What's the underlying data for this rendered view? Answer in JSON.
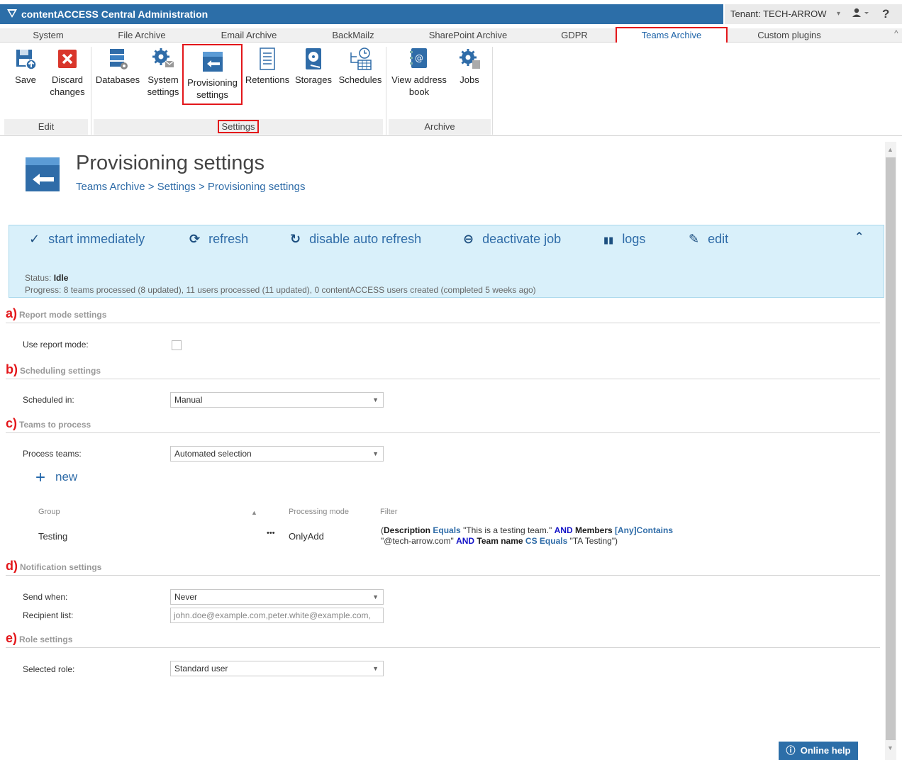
{
  "app": {
    "title": "contentACCESS Central Administration"
  },
  "tenant": {
    "label": "Tenant: TECH-ARROW",
    "help_glyph": "?"
  },
  "menu_tabs": [
    "System",
    "File Archive",
    "Email Archive",
    "BackMailz",
    "SharePoint Archive",
    "GDPR",
    "Teams Archive",
    "Custom plugins"
  ],
  "active_tab": "Teams Archive",
  "ribbon": {
    "save": "Save",
    "discard_1": "Discard",
    "discard_2": "changes",
    "databases": "Databases",
    "system_1": "System",
    "system_2": "settings",
    "prov_1": "Provisioning",
    "prov_2": "settings",
    "retentions": "Retentions",
    "storages": "Storages",
    "schedules": "Schedules",
    "address_1": "View address",
    "address_2": "book",
    "jobs": "Jobs",
    "groups": {
      "edit": "Edit",
      "settings": "Settings",
      "archive": "Archive"
    }
  },
  "page": {
    "title": "Provisioning settings",
    "breadcrumb": "Teams Archive > Settings > Provisioning settings"
  },
  "actions": {
    "start": "start immediately",
    "refresh": "refresh",
    "auto_refresh": "disable auto refresh",
    "deactivate": "deactivate job",
    "logs": "logs",
    "edit": "edit"
  },
  "status": {
    "label": "Status:",
    "value": "Idle",
    "progress_label": "Progress:",
    "progress": "8 teams processed (8 updated), 11 users processed (11 updated), 0 contentACCESS users created (completed 5 weeks ago)"
  },
  "sections": {
    "a": {
      "letter": "a)",
      "title": "Report mode settings"
    },
    "b": {
      "letter": "b)",
      "title": "Scheduling settings"
    },
    "c": {
      "letter": "c)",
      "title": "Teams to process"
    },
    "d": {
      "letter": "d)",
      "title": "Notification settings"
    },
    "e": {
      "letter": "e)",
      "title": "Role settings"
    }
  },
  "fields": {
    "report_mode_label": "Use report mode:",
    "report_mode_checked": false,
    "scheduled_label": "Scheduled in:",
    "scheduled_value": "Manual",
    "process_label": "Process teams:",
    "process_value": "Automated selection",
    "new_label": "new",
    "send_label": "Send when:",
    "send_value": "Never",
    "recipient_label": "Recipient list:",
    "recipient_placeholder": "john.doe@example.com,peter.white@example.com,",
    "role_label": "Selected role:",
    "role_value": "Standard user"
  },
  "table": {
    "headers": {
      "group": "Group",
      "mode": "Processing mode",
      "filter": "Filter"
    },
    "row": {
      "group": "Testing",
      "menu": "•••",
      "mode": "OnlyAdd",
      "filter": {
        "open": "(",
        "k1": "Description",
        "op1": "Equals",
        "v1": "\"This is a testing team.\"",
        "and1": "AND",
        "k2": "Members",
        "op2": "[Any]Contains",
        "v2": "\"@tech-arrow.com\"",
        "and2": "AND",
        "k3": "Team name",
        "op3": "CS Equals",
        "v3": "\"TA Testing\")"
      }
    }
  },
  "help_button": "Online help",
  "colors": {
    "accent": "#2c6ea8",
    "highlight": "#e3161a",
    "actionbar": "#d9f0fa"
  }
}
